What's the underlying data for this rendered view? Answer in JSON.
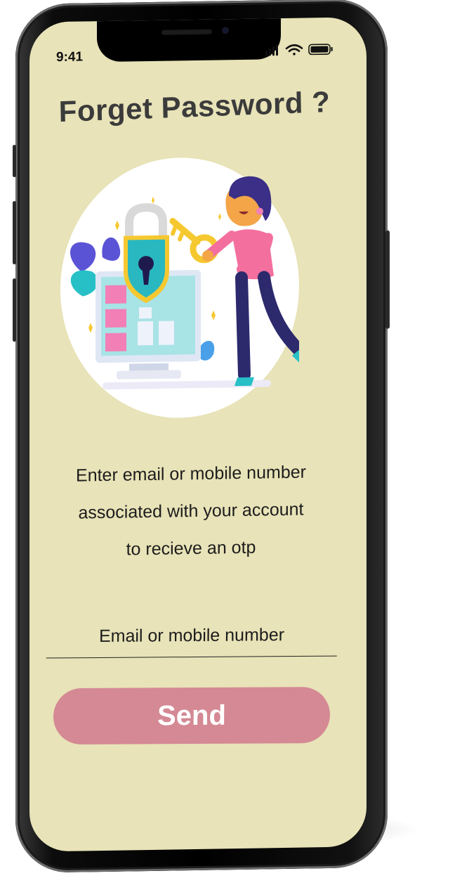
{
  "status_bar": {
    "time": "9:41"
  },
  "header": {
    "title": "Forget  Password ?"
  },
  "instructions": {
    "line1": "Enter email or mobile number",
    "line2": "associated with your account",
    "line3": "to recieve an otp"
  },
  "form": {
    "placeholder": "Email or mobile number",
    "value": ""
  },
  "actions": {
    "send_label": "Send"
  },
  "colors": {
    "screen_background": "#e8e3b8",
    "send_button": "#d48994",
    "title_text": "#3b3b3b",
    "device_frame": "#000000"
  },
  "icons": [
    "signal-icon",
    "wifi-icon",
    "battery-icon"
  ]
}
